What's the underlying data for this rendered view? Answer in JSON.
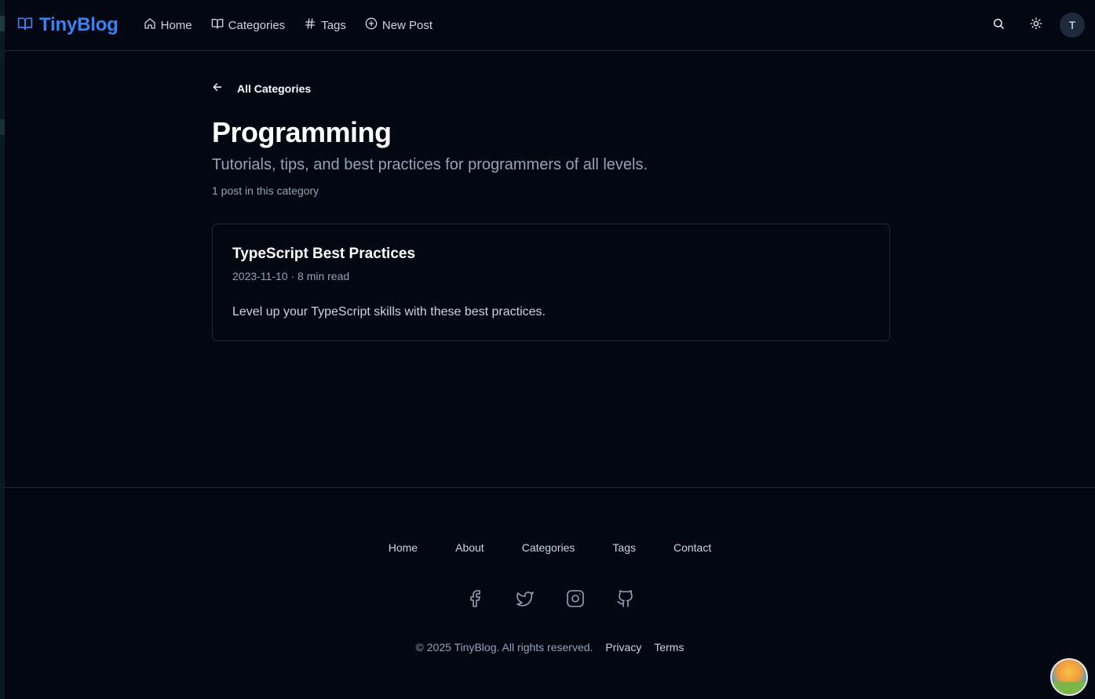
{
  "header": {
    "brand": "TinyBlog",
    "nav": [
      {
        "label": "Home",
        "icon": "home-icon"
      },
      {
        "label": "Categories",
        "icon": "book-icon"
      },
      {
        "label": "Tags",
        "icon": "hash-icon"
      },
      {
        "label": "New Post",
        "icon": "plus-circle-icon"
      }
    ],
    "avatar_initial": "T"
  },
  "main": {
    "back_label": "All Categories",
    "title": "Programming",
    "description": "Tutorials, tips, and best practices for programmers of all levels.",
    "post_count": "1 post in this category",
    "posts": [
      {
        "title": "TypeScript Best Practices",
        "meta": "2023-11-10 · 8 min read",
        "excerpt": "Level up your TypeScript skills with these best practices."
      }
    ]
  },
  "footer": {
    "links": [
      "Home",
      "About",
      "Categories",
      "Tags",
      "Contact"
    ],
    "social": [
      "facebook-icon",
      "twitter-icon",
      "instagram-icon",
      "github-icon"
    ],
    "copyright": "© 2025 TinyBlog. All rights reserved.",
    "privacy": "Privacy",
    "terms": "Terms"
  },
  "colors": {
    "background": "#030712",
    "accent": "#3b82f6",
    "border": "#1e293b",
    "muted_text": "#94a3b8"
  }
}
